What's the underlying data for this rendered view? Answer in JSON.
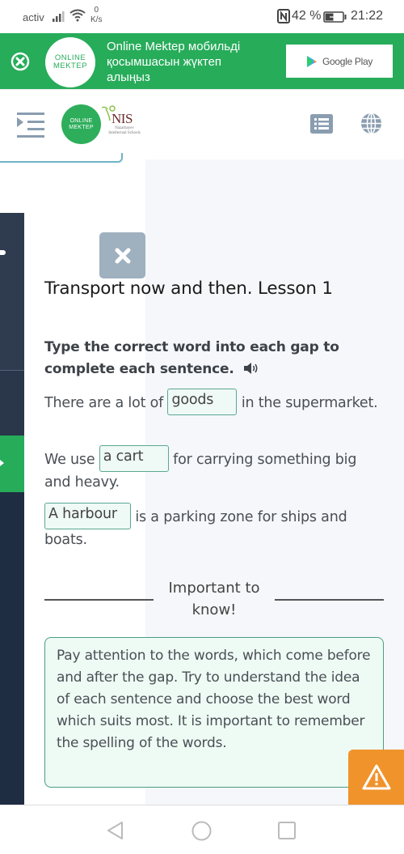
{
  "status_bar": {
    "carrier": "activ",
    "net_speed_value": "0",
    "net_speed_unit": "K/s",
    "battery_percent": "42 %",
    "time": "21:22",
    "icons": [
      "signal-icon",
      "wifi-icon",
      "nfc-icon",
      "battery-charging-icon"
    ]
  },
  "banner": {
    "logo_line1": "ONLINE",
    "logo_line2": "MEKTEP",
    "text": "Online Mektep мобильді қосымшасын жүктеп алыңыз",
    "store_button_label": "Google Play",
    "colors": {
      "background": "#27ac5a"
    }
  },
  "header": {
    "logo_line1": "ONLINE",
    "logo_line2": "MEKTEP",
    "partner_title": "NIS",
    "partner_sub": "Nazarbayev Intellectual Schools",
    "icons": [
      "menu-icon",
      "list-icon",
      "globe-icon"
    ]
  },
  "lesson": {
    "title": "Transport now and then. Lesson 1",
    "instruction": "Type the correct word into each gap to complete each sentence.",
    "sentences": [
      {
        "before": "There are a lot of ",
        "gap_value": "goods",
        "after": " in the supermarket."
      },
      {
        "before": "We use ",
        "gap_value": "a cart",
        "after": " for carrying something big and heavy."
      },
      {
        "before": "",
        "gap_value": "A harbour",
        "after": " is a parking zone for ships and boats."
      }
    ],
    "important_heading": "Important to know!",
    "info_text": "Pay attention to the words, which come before and after the gap. Try to understand the idea of each sentence and choose the best word which suits most. It is important to remember the spelling of the words."
  },
  "colors": {
    "accent_green": "#27ac5a",
    "gap_border": "#5aa893",
    "warning": "#f0932b",
    "sidebar_dark": "#1f2d43",
    "close_button": "#9fb0bf"
  }
}
